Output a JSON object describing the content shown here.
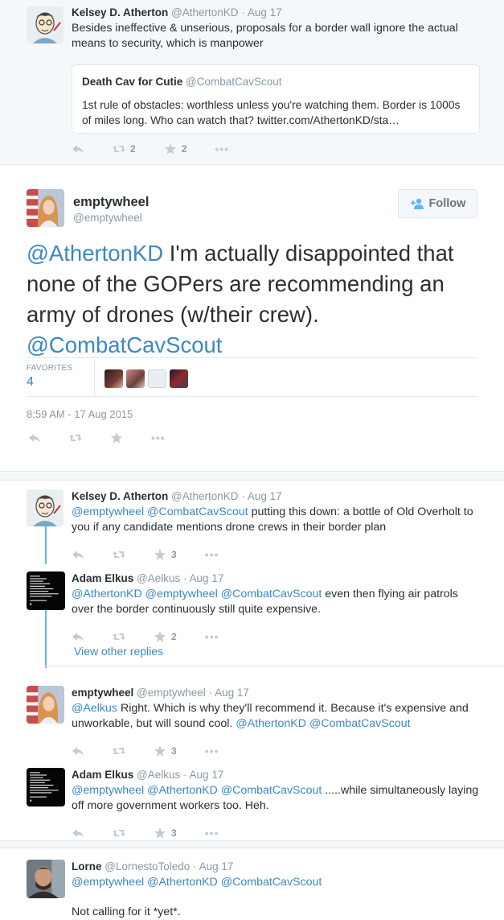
{
  "top": {
    "name": "Kelsey D. Atherton",
    "handle": "@AthertonKD",
    "time": "· Aug 17",
    "text": "Besides ineffective & unserious, proposals for a border wall ignore the actual means to security, which is manpower",
    "quote": {
      "name": "Death Cav for Cutie",
      "handle": "@CombatCavScout",
      "text": "1st rule of obstacles: worthless unless you're watching them. Border is 1000s of miles long. Who can watch that? twitter.com/AthertonKD/sta…"
    },
    "retweets": "2",
    "favorites": "2"
  },
  "main": {
    "name": "emptywheel",
    "handle": "@emptywheel",
    "follow_label": "Follow",
    "text_mention1": "@AthertonKD",
    "text_body": " I'm actually disappointed that none of the GOPers are recommending an army of drones (w/their crew). ",
    "text_mention2": "@CombatCavScout",
    "favorites_label": "FAVORITES",
    "favorites_count": "4",
    "timestamp": "8:59 AM - 17 Aug 2015"
  },
  "replies": [
    {
      "name": "Kelsey D. Atherton",
      "handle": "@AthertonKD",
      "time": "· Aug 17",
      "mentions": "@emptywheel @CombatCavScout",
      "text": " putting this down: a bottle of Old Overholt to you if any candidate mentions drone crews in their border plan",
      "favorites": "3"
    },
    {
      "name": "Adam Elkus",
      "handle": "@Aelkus",
      "time": "· Aug 17",
      "mentions": "@AthertonKD @emptywheel @CombatCavScout",
      "text": " even then flying air patrols over the border continuously still quite expensive.",
      "favorites": "2"
    },
    {
      "name": "emptywheel",
      "handle": "@emptywheel",
      "time": "· Aug 17",
      "mention_lead": "@Aelkus",
      "text": " Right. Which is why they'll recommend it. Because it's expensive and unworkable, but will sound cool. ",
      "mentions_tail": "@AthertonKD @CombatCavScout",
      "favorites": "3"
    },
    {
      "name": "Adam Elkus",
      "handle": "@Aelkus",
      "time": "· Aug 17",
      "mentions": "@emptywheel @AthertonKD @CombatCavScout",
      "text": " .....while simultaneously laying off more government workers too. Heh.",
      "favorites": "3"
    },
    {
      "name": "Lorne",
      "handle": "@LornestoToledo",
      "time": "· Aug 17",
      "mentions": "@emptywheel @AthertonKD @CombatCavScout",
      "text": "Not calling for it *yet*."
    }
  ],
  "view_other_replies": "View other replies",
  "colors": {
    "link": "#3b88c3",
    "muted": "#8899a6",
    "thread_line": "#66b5f7",
    "background_top": "#f5f8fa"
  }
}
